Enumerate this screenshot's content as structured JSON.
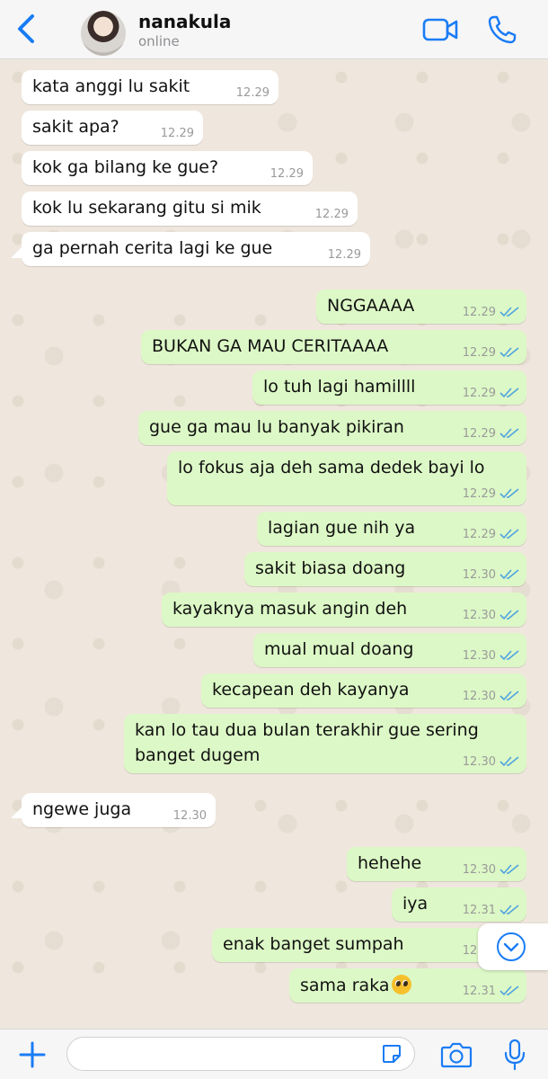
{
  "header": {
    "contact_name": "nanakula",
    "status": "online"
  },
  "messages": [
    {
      "dir": "in",
      "text": "kata anggi lu sakit",
      "time": "12.29"
    },
    {
      "dir": "in",
      "text": "sakit apa?",
      "time": "12.29"
    },
    {
      "dir": "in",
      "text": "kok ga bilang ke gue?",
      "time": "12.29"
    },
    {
      "dir": "in",
      "text": "kok lu sekarang gitu si mik",
      "time": "12.29"
    },
    {
      "dir": "in",
      "text": "ga pernah cerita lagi ke gue",
      "time": "12.29"
    },
    {
      "dir": "out",
      "text": "NGGAAAA",
      "time": "12.29",
      "status": "read"
    },
    {
      "dir": "out",
      "text": "BUKAN GA MAU CERITAAAA",
      "time": "12.29",
      "status": "read"
    },
    {
      "dir": "out",
      "text": "lo tuh lagi hamillll",
      "time": "12.29",
      "status": "read"
    },
    {
      "dir": "out",
      "text": "gue ga mau lu banyak pikiran",
      "time": "12.29",
      "status": "read"
    },
    {
      "dir": "out",
      "text": "lo fokus aja deh sama dedek bayi lo",
      "time": "12.29",
      "status": "read"
    },
    {
      "dir": "out",
      "text": "lagian gue nih ya",
      "time": "12.29",
      "status": "read"
    },
    {
      "dir": "out",
      "text": "sakit biasa doang",
      "time": "12.30",
      "status": "read"
    },
    {
      "dir": "out",
      "text": "kayaknya masuk angin deh",
      "time": "12.30",
      "status": "read"
    },
    {
      "dir": "out",
      "text": "mual mual doang",
      "time": "12.30",
      "status": "read"
    },
    {
      "dir": "out",
      "text": "kecapean deh kayanya",
      "time": "12.30",
      "status": "read"
    },
    {
      "dir": "out",
      "text": "kan lo tau dua bulan terakhir gue sering banget dugem",
      "time": "12.30",
      "status": "read"
    },
    {
      "dir": "in",
      "text": "ngewe juga",
      "time": "12.30"
    },
    {
      "dir": "out",
      "text": "hehehe",
      "time": "12.30",
      "status": "read"
    },
    {
      "dir": "out",
      "text": "iya",
      "time": "12.31",
      "status": "read"
    },
    {
      "dir": "out",
      "text": "enak banget sumpah",
      "time": "12.31",
      "status": "read"
    },
    {
      "dir": "out",
      "text": "sama raka",
      "emoji": "pleading-face",
      "time": "12.31",
      "status": "read"
    }
  ],
  "input": {
    "value": "",
    "placeholder": ""
  },
  "icons": {
    "back": "chevron-left-icon",
    "video": "video-camera-icon",
    "call": "phone-icon",
    "scroll": "chevron-down-circle-icon",
    "attach": "plus-icon",
    "sticker": "sticker-icon",
    "camera": "camera-icon",
    "mic": "microphone-icon"
  },
  "colors": {
    "accent": "#1a7cf5",
    "incoming_bubble": "#ffffff",
    "outgoing_bubble": "#dcf8c6",
    "read_ticks": "#4fa3e0",
    "chat_background": "#efe7dd"
  }
}
